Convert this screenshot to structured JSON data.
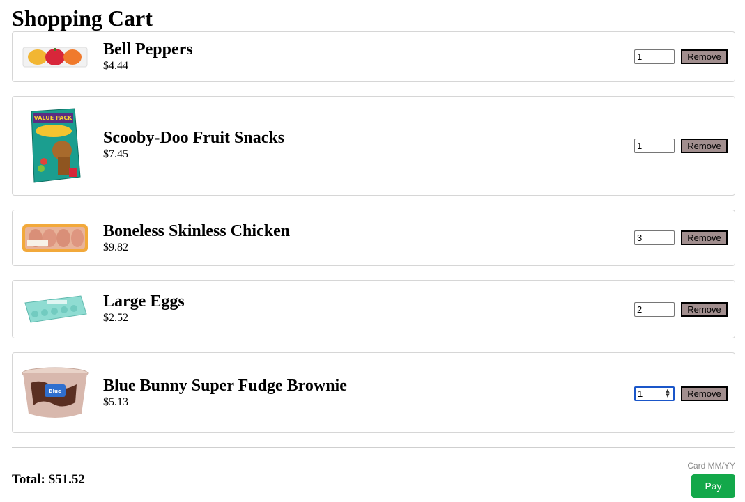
{
  "page": {
    "title": "Shopping Cart"
  },
  "cart": {
    "items": [
      {
        "name": "Bell Peppers",
        "price": "$4.44",
        "quantity": "1",
        "remove_label": "Remove",
        "image_icon": "bell-peppers-photo"
      },
      {
        "name": "Scooby-Doo Fruit Snacks",
        "price": "$7.45",
        "quantity": "1",
        "remove_label": "Remove",
        "image_icon": "fruit-snacks-box-photo"
      },
      {
        "name": "Boneless Skinless Chicken",
        "price": "$9.82",
        "quantity": "3",
        "remove_label": "Remove",
        "image_icon": "chicken-package-photo"
      },
      {
        "name": "Large Eggs",
        "price": "$2.52",
        "quantity": "2",
        "remove_label": "Remove",
        "image_icon": "egg-carton-photo"
      },
      {
        "name": "Blue Bunny Super Fudge Brownie",
        "price": "$5.13",
        "quantity": "1",
        "remove_label": "Remove",
        "image_icon": "ice-cream-tub-photo"
      }
    ]
  },
  "summary": {
    "total_label": "Total: $51.52"
  },
  "payment": {
    "card_field_placeholder": "Card MM/YY",
    "pay_label": "Pay"
  },
  "colors": {
    "remove_button_bg": "#a18e8e",
    "pay_button_bg": "#13a84a",
    "focus_ring": "#1a56c9"
  }
}
